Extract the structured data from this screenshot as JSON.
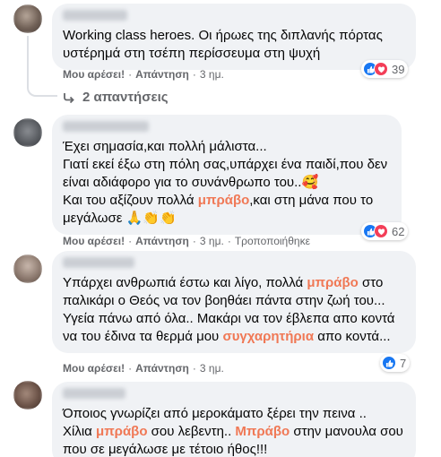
{
  "comments": [
    {
      "text": "Working class heroes. Οι ήρωες της διπλανής πόρτας υστέρημά στη τσέπη περίσσευμα στη ψυχή",
      "like_label": "Μου αρέσει!",
      "reply_label": "Απάντηση",
      "time": "3 ημ.",
      "reaction_count": "39",
      "replies_label": "2 απαντήσεις"
    },
    {
      "text_parts": [
        "Έχει σημασία,και πολλή μάλιστα...\nΓιατί εκεί έξω στη πόλη σας,υπάρχει ένα παιδί,που δεν είναι αδιάφορο για το συνάνθρωπο του..🥰\nΚαι του αξίζουν πολλά ",
        "μπράβο",
        ",και στη μάνα που το μεγάλωσε 🙏👏👏"
      ],
      "like_label": "Μου αρέσει!",
      "reply_label": "Απάντηση",
      "time": "3 ημ.",
      "edited_label": "Τροποποιήθηκε",
      "reaction_count": "62"
    },
    {
      "text_parts": [
        "Υπάρχει ανθρωπιά έστω και λίγο, πολλά ",
        "μπράβο",
        " στο παλικάρι ο Θεός να τον βοηθάει πάντα στην ζωή του... Υγεία πάνω από όλα.. Μακάρι να τον έβλεπα απο κοντά να του έδινα τα θερμά μου ",
        "συγχαρητήρια",
        " απο κοντά..."
      ],
      "like_label": "Μου αρέσει!",
      "reply_label": "Απάντηση",
      "time": "3 ημ.",
      "reaction_count": "7"
    },
    {
      "text_parts": [
        "Όποιος γνωρίζει από μεροκάματο ξέρει την πεινα ..\nΧίλια ",
        "μπράβο",
        " σου λεβεντη.. ",
        "Μπράβο",
        " στην μανουλα σου που σε μεγάλωσε με τέτοιο ήθος!!!"
      ]
    }
  ],
  "colors": {
    "bubble": "#f0f2f5",
    "highlight": "#f07855",
    "meta": "#65676b",
    "like": "#1877f2",
    "love": "#f33e58"
  }
}
